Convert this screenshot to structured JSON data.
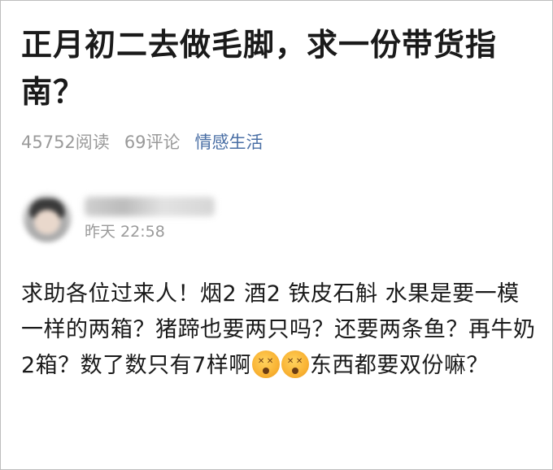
{
  "post": {
    "title": "正月初二去做毛脚，求一份带货指南？",
    "reads": "45752阅读",
    "comments": "69评论",
    "category": "情感生活"
  },
  "author": {
    "name": "",
    "time": "昨天 22:58"
  },
  "content": {
    "text_1": "求助各位过来人！烟2 酒2 铁皮石斛 水果是要一模一样的两箱？猪蹄也要两只吗？还要两条鱼？再牛奶2箱？数了数只有7样啊",
    "emoji_icon": "dizzy-face-icon",
    "text_2": "东西都要双份嘛？"
  }
}
